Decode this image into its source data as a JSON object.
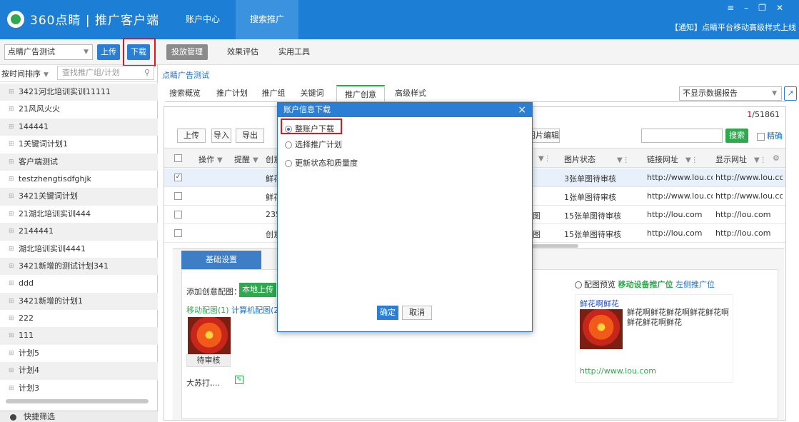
{
  "app": {
    "name": "360点睛 | 推广客户端",
    "tabs": [
      "账户中心",
      "搜索推广"
    ],
    "notice": "【通知】点睛平台移动高级样式上线",
    "window_controls": [
      "≡",
      "–",
      "❐",
      "✕"
    ]
  },
  "left": {
    "account_select": "点睛广告测试",
    "upload_label": "上传",
    "download_label": "下载",
    "sort_label": "按时间排序",
    "search_placeholder": "查找推广组/计划",
    "plans": [
      "3421河北培训实训11111",
      "21风风火火",
      "144441",
      "1关键词计划1",
      "客户端测试",
      "testzhengtisdfghjk",
      "3421关键词计划",
      "21湖北培训实训444",
      "2144441",
      "湖北培训实训4441",
      "3421新增的测试计划341",
      "ddd",
      "3421新增的计划1",
      "222",
      "111",
      "计划5",
      "计划4",
      "计划3"
    ],
    "quick_filter": "快捷筛选"
  },
  "subtabs": [
    "投放管理",
    "效果评估",
    "实用工具"
  ],
  "main": {
    "breadcrumb": "点睛广告测试",
    "content_tabs": [
      "搜索概览",
      "推广计划",
      "推广组",
      "关键词",
      "推广创意",
      "高级样式"
    ],
    "report_select": "不显示数据报告",
    "page_current": "1",
    "page_total": "/51861",
    "toolbar": {
      "upload": "上传",
      "import": "导入",
      "export": "导出",
      "image_edit": "图片编辑",
      "search": "搜索",
      "precise": "精确"
    },
    "columns": {
      "op": "操作",
      "remind": "提醒",
      "creative": "创意",
      "img_status": "图片状态",
      "link_url": "链接网址",
      "display_url": "显示网址"
    },
    "rows": [
      {
        "checked": "✓",
        "creative": "鲜花",
        "mid": "",
        "img_status": "3张单图待审核",
        "link": "http://www.lou.con",
        "display": "http://www.lou.con"
      },
      {
        "checked": "",
        "creative": "鲜花",
        "mid": "",
        "img_status": "1张单图待审核",
        "link": "http://www.lou.con",
        "display": "http://www.lou.con"
      },
      {
        "checked": "",
        "creative": "235",
        "mid": "图",
        "img_status": "15张单图待审核",
        "link": "http://lou.com",
        "display": "http://lou.com"
      },
      {
        "checked": "",
        "creative": "创意",
        "mid": "图",
        "img_status": "15张单图待审核",
        "link": "http://lou.com",
        "display": "http://lou.com"
      }
    ],
    "detail": {
      "tab": "基础设置",
      "add_label": "添加创意配图：",
      "upload_local": "本地上传",
      "mobile_img": "移动配图(1)",
      "pc_img": "计算机配图(2)",
      "pending": "待审核",
      "filename": "大苏打,...",
      "preview_label": "配图预览",
      "mobile_slot": "移动设备推广位",
      "left_slot": "左侧推广位",
      "preview_title": "鲜花啊鲜花",
      "preview_desc": "鲜花啊鲜花鲜花啊鲜花鲜花啊鲜花鲜花啊鲜花",
      "preview_url": "http://www.lou.com"
    }
  },
  "dialog": {
    "title": "账户信息下载",
    "close": "×",
    "options": [
      "整账户下载",
      "选择推广计划",
      "更新状态和质量度"
    ],
    "ok": "确定",
    "cancel": "取消"
  }
}
